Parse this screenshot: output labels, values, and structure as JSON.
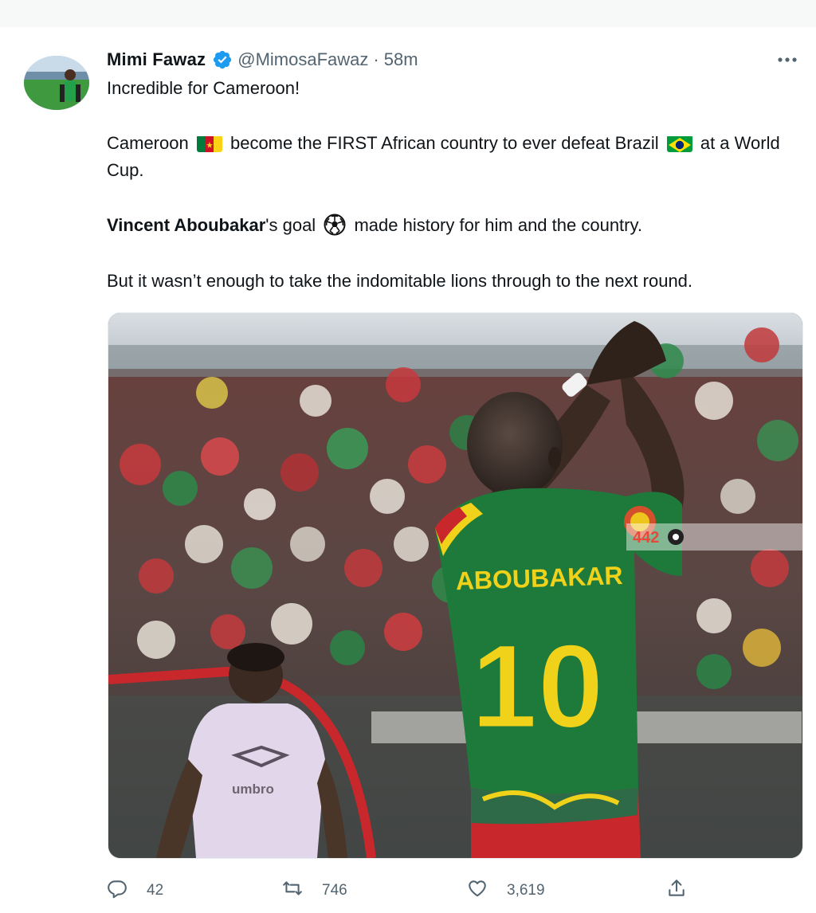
{
  "tweet": {
    "author": {
      "name": "Mimi Fawaz",
      "handle": "@MimosaFawaz",
      "verified": true,
      "separator": "·",
      "time": "58m"
    },
    "more_icon": "ellipsis-icon",
    "text": {
      "line1": "Incredible for Cameroon!",
      "p2_part1": "Cameroon",
      "p2_part2": "become the FIRST African country to ever defeat Brazil",
      "p2_part3": "at a World Cup.",
      "p3_bold": "Vincent Aboubakar",
      "p3_part1": "'s goal",
      "p3_part2": "made history for him and the country.",
      "p4": "But it wasn’t enough to take the indomitable lions through to the next round."
    },
    "emoji": {
      "cameroon_flag": "flag-cameroon-icon",
      "brazil_flag": "flag-brazil-icon",
      "soccer_ball": "soccer-ball-icon"
    },
    "media": {
      "jersey_name": "ABOUBAKAR",
      "jersey_number": "10",
      "opponent_kit_text": "umbro",
      "watermark": "442"
    },
    "actions": {
      "reply_count": "42",
      "retweet_count": "746",
      "like_count": "3,619"
    }
  },
  "colors": {
    "text": "#0f1419",
    "secondary": "#536471",
    "verified": "#1d9bf0",
    "jersey_green": "#1e7a3a",
    "jersey_yellow": "#f1d21b"
  }
}
